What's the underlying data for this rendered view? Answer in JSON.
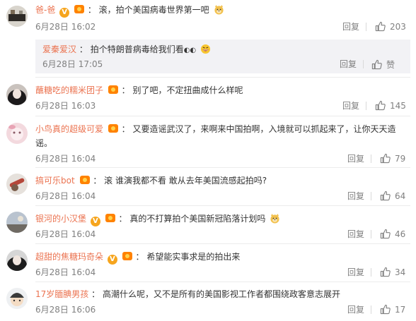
{
  "comments": [
    {
      "user": "爸-爸",
      "colon": "：",
      "text": "滚，拍个美国病毒世界第一吧",
      "date": "6月28日 16:02",
      "reply_label": "回复",
      "likes": "203",
      "has_v": true,
      "emoji": "doge"
    },
    {
      "user": "蘸糖吃的糯米团子",
      "colon": "：",
      "text": "别了吧，不定扭曲成什么样呢",
      "date": "6月28日 16:03",
      "reply_label": "回复",
      "likes": "145"
    },
    {
      "user": "小鸟真的超级可爱",
      "colon": "：",
      "text": "又要造谣武汉了，来啊来中国拍啊，入境就可以抓起来了，让你天天造",
      "text2": "谣。",
      "date": "6月28日 16:04",
      "reply_label": "回复",
      "likes": "79"
    },
    {
      "user": "搞可乐bot",
      "colon": "：",
      "text": "滚 谁演我都不看 敢从去年美国流感起拍吗?",
      "date": "6月28日 16:04",
      "reply_label": "回复",
      "likes": "64"
    },
    {
      "user": "银河的小汉堡",
      "colon": "：",
      "text": "真的不打算拍个美国新冠陷落计划吗",
      "date": "6月28日 16:04",
      "reply_label": "回复",
      "likes": "46",
      "has_v": true,
      "emoji": "doge"
    },
    {
      "user": "超甜的焦糖玛奇朵",
      "colon": "：",
      "text": "希望能实事求是的拍出来",
      "date": "6月28日 16:04",
      "reply_label": "回复",
      "likes": "34",
      "has_v": true
    },
    {
      "user": "17岁腼腆男孩",
      "colon": "：",
      "text": "高潮什么呢，又不是所有的美国影视工作者都围绕政客意志展开",
      "date": "6月28日 16:06",
      "reply_label": "回复",
      "likes": "17"
    }
  ],
  "subreply": {
    "user": "爱秦爱汉",
    "colon": "：",
    "text": "拍个特朗普病毒给我们看",
    "text_suffix": "◐◐",
    "date": "6月28日 17:05",
    "reply_label": "回复",
    "like_label": "赞",
    "emoji": "grin"
  },
  "icons": {
    "like": "thumbs-up-icon",
    "vip": "vip-level-icon",
    "verified": "verified-v-icon"
  },
  "colors": {
    "username": "#eb7350",
    "meta": "#808080",
    "subreply_bg": "#f2f2f5"
  }
}
